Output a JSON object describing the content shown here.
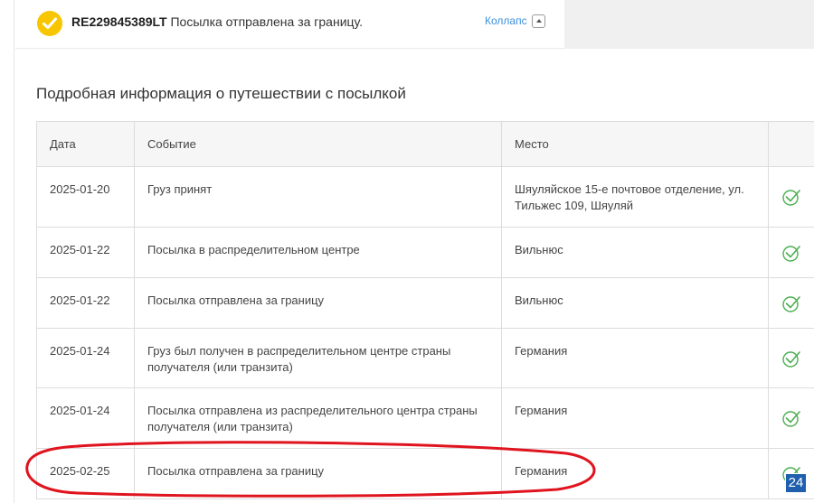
{
  "header": {
    "tracking_number": "RE229845389LT",
    "status_text": "Посылка отправлена за границу.",
    "collapse_label": "Коллапс"
  },
  "section_title": "Подробная информация о путешествии с посылкой",
  "table": {
    "columns": [
      "Дата",
      "Событие",
      "Место",
      ""
    ],
    "rows": [
      {
        "date": "2025-01-20",
        "event": "Груз принят",
        "place": "Шяуляйское 15-е почтовое отделение, ул. Тильжес 109, Шяуляй",
        "status": "check-icon"
      },
      {
        "date": "2025-01-22",
        "event": "Посылка в распределительном центре",
        "place": "Вильнюс",
        "status": "check-icon"
      },
      {
        "date": "2025-01-22",
        "event": "Посылка отправлена за границу",
        "place": "Вильнюс",
        "status": "check-icon"
      },
      {
        "date": "2025-01-24",
        "event": "Груз был получен в распределительном центре страны получателя (или транзита)",
        "place": "Германия",
        "status": "check-icon"
      },
      {
        "date": "2025-01-24",
        "event": "Посылка отправлена из распределительного центра страны получателя (или транзита)",
        "place": "Германия",
        "status": "check-icon"
      },
      {
        "date": "2025-02-25",
        "event": "Посылка отправлена за границу",
        "place": "Германия",
        "status": "check-icon"
      }
    ]
  },
  "badge": "24",
  "colors": {
    "accent_yellow": "#f7c600",
    "check_green": "#4caf50",
    "link_blue": "#3d8fd9",
    "highlight_red": "#e0141e"
  }
}
